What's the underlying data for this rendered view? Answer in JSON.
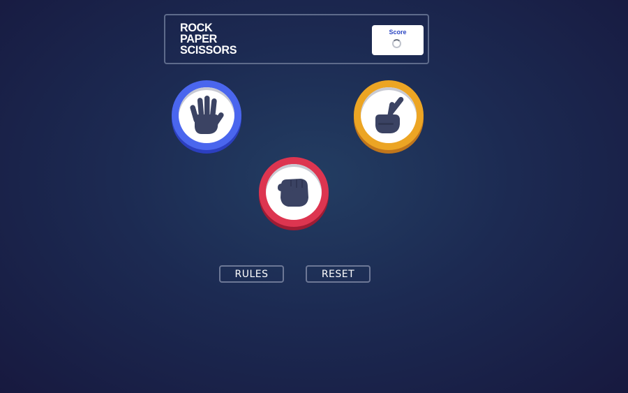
{
  "header": {
    "title_lines": [
      "ROCK",
      "PAPER",
      "SCISSORS"
    ],
    "score_label": "Score",
    "score_state": "loading"
  },
  "choices": [
    {
      "id": "paper",
      "icon": "paper-hand-icon",
      "ring_color": "#4a66ee"
    },
    {
      "id": "scissors",
      "icon": "scissors-hand-icon",
      "ring_color": "#eca524"
    },
    {
      "id": "rock",
      "icon": "rock-fist-icon",
      "ring_color": "#dd3550"
    }
  ],
  "buttons": {
    "rules_label": "RULES",
    "reset_label": "RESET"
  },
  "colors": {
    "icon_fill": "#3b4363",
    "score_label": "#2a45c2"
  }
}
